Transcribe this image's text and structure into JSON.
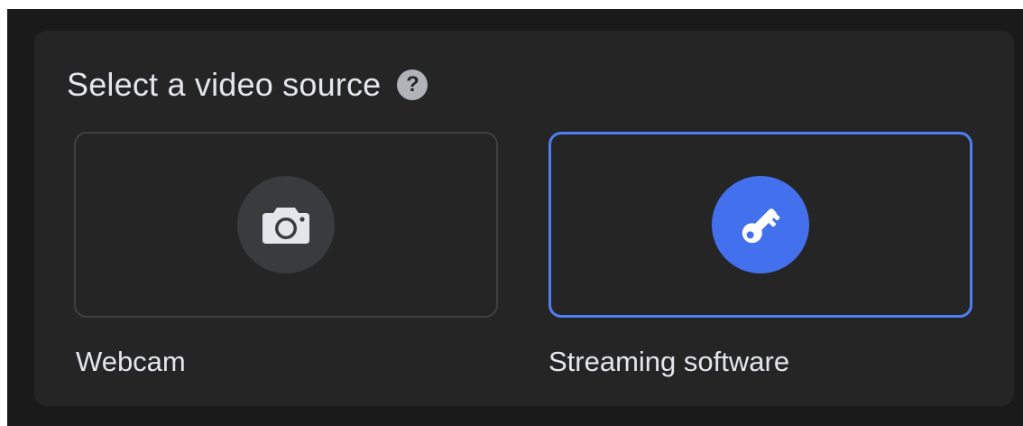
{
  "header": {
    "title": "Select a video source",
    "help_icon": "?"
  },
  "options": [
    {
      "id": "webcam",
      "label": "Webcam",
      "icon": "camera-icon",
      "selected": false
    },
    {
      "id": "streaming",
      "label": "Streaming software",
      "icon": "key-icon",
      "selected": true
    }
  ],
  "colors": {
    "accent": "#4e7ff0",
    "accent_fill": "#4370ec",
    "panel": "#252526",
    "text": "#e4e6eb"
  }
}
